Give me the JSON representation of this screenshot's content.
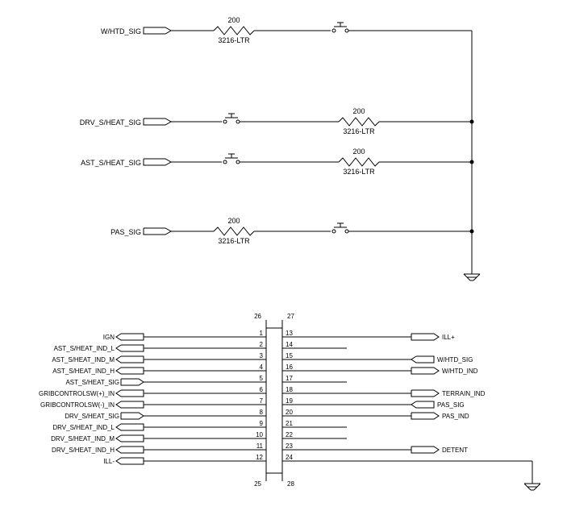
{
  "signals_top": [
    {
      "label": "W/HTD_SIG"
    },
    {
      "label": "DRV_S/HEAT_SIG"
    },
    {
      "label": "AST_S/HEAT_SIG"
    },
    {
      "label": "PAS_SIG"
    }
  ],
  "resistors": {
    "r1": {
      "value": "200",
      "footprint": "3216-LTR"
    },
    "r2": {
      "value": "200",
      "footprint": "3216-LTR"
    },
    "r3": {
      "value": "200",
      "footprint": "3216-LTR"
    },
    "r4": {
      "value": "200",
      "footprint": "3216-LTR"
    }
  },
  "connector": {
    "pins_top_left": "26",
    "pins_top_right": "27",
    "pins_bottom_left": "25",
    "pins_bottom_right": "28",
    "left_pins": [
      "1",
      "2",
      "3",
      "4",
      "5",
      "6",
      "7",
      "8",
      "9",
      "10",
      "11",
      "12"
    ],
    "right_pins": [
      "13",
      "14",
      "15",
      "16",
      "17",
      "18",
      "19",
      "20",
      "21",
      "22",
      "23",
      "24"
    ],
    "left_labels": [
      "IGN",
      "AST_S/HEAT_IND_L",
      "AST_S/HEAT_IND_M",
      "AST_S/HEAT_IND_H",
      "AST_S/HEAT_SIG",
      "GRIBCONTROLSW(+)_IN",
      "GRIBCONTROLSW(-)_IN",
      "DRV_S/HEAT_SIG",
      "DRV_S/HEAT_IND_L",
      "DRV_S/HEAT_IND_M",
      "DRV_S/HEAT_IND_H",
      "ILL-"
    ],
    "right_signals": {
      "p13": "ILL+",
      "p15": "W/HTD_SIG",
      "p16": "W/HTD_IND",
      "p18": "TERRAIN_IND",
      "p19": "PAS_SIG",
      "p20": "PAS_IND",
      "p23": "DETENT"
    }
  }
}
